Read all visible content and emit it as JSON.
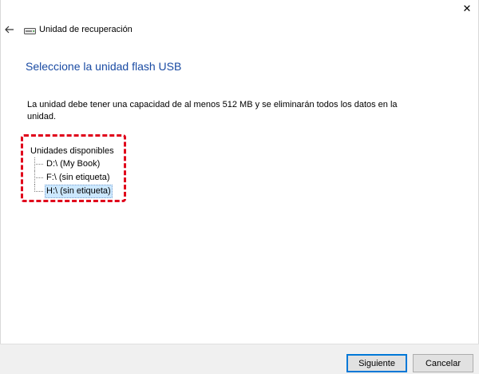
{
  "window": {
    "title": "Unidad de recuperación",
    "close_glyph": "✕",
    "back_icon": "back-arrow-icon",
    "title_icon": "drive-icon"
  },
  "main": {
    "heading": "Seleccione la unidad flash USB",
    "instruction": "La unidad debe tener una capacidad de al menos 512 MB y se eliminarán todos los datos en la unidad.",
    "tree": {
      "root_label": "Unidades disponibles",
      "items": [
        {
          "label": "D:\\ (My Book)",
          "selected": false
        },
        {
          "label": "F:\\ (sin etiqueta)",
          "selected": false
        },
        {
          "label": "H:\\ (sin etiqueta)",
          "selected": true
        }
      ]
    },
    "highlight_color": "#e0001a",
    "heading_color": "#1a4ba3"
  },
  "footer": {
    "next_label": "Siguiente",
    "cancel_label": "Cancelar"
  }
}
